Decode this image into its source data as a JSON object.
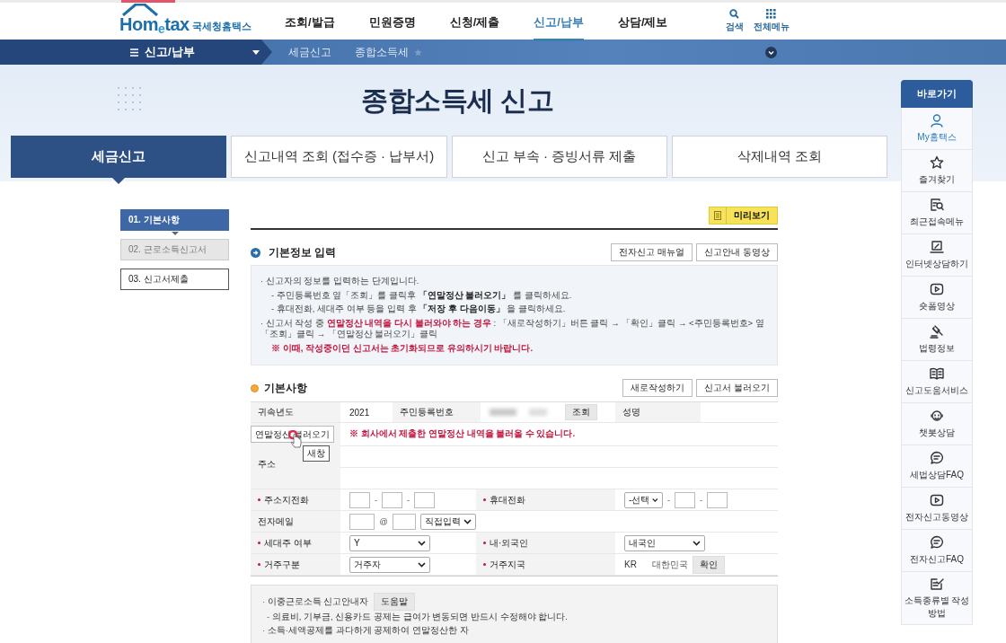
{
  "header": {
    "logo_text": "Hom$_{e}$tax",
    "logo_caption": "국세청홈택스",
    "nav": [
      {
        "label": "조회/발급",
        "selected": false
      },
      {
        "label": "민원증명",
        "selected": false
      },
      {
        "label": "신청/제출",
        "selected": false
      },
      {
        "label": "신고/납부",
        "selected": true
      },
      {
        "label": "상담/제보",
        "selected": false
      }
    ],
    "utilities": [
      {
        "kind": "search",
        "label": "검색"
      },
      {
        "kind": "grid",
        "label": "전체메뉴"
      }
    ]
  },
  "subbar": {
    "menu": "신고/납부",
    "breadcrumb": [
      "세금신고",
      "종합소득세"
    ]
  },
  "page_title": "종합소득세 신고",
  "tabs": [
    {
      "label": "세금신고",
      "selected": true
    },
    {
      "label": "신고내역 조회 (접수증 · 납부서)",
      "selected": false
    },
    {
      "label": "신고 부속 · 증빙서류 제출",
      "selected": false
    },
    {
      "label": "삭제내역 조회",
      "selected": false
    }
  ],
  "steps": [
    {
      "label": "01. 기본사항",
      "selected": true,
      "disabled": false
    },
    {
      "label": "02. 근로소득신고서",
      "selected": false,
      "disabled": true
    },
    {
      "label": "03. 신고서제출",
      "selected": false,
      "disabled": false
    }
  ],
  "preview_button": "미리보기",
  "basic_input": {
    "title": "기본정보 입력",
    "buttons": [
      "전자신고 매뉴얼",
      "신고안내 동영상"
    ],
    "notes": [
      {
        "kind": "bullet",
        "marker": "·",
        "text": "신고자의 정보를 입력하는 단계입니다."
      },
      {
        "kind": "dash",
        "marker": "-",
        "text": "주민등록번호 옆「조회」를 클릭후 **「연말정산 불러오기」** 를 클릭하세요."
      },
      {
        "kind": "dash",
        "marker": "-",
        "text": "휴대전화, 세대주 여부 등을 입력 후 **「저장 후 다음이동」** 을 클릭하세요."
      },
      {
        "kind": "bullet",
        "marker": "·",
        "text": "신고서 작성 중 **연말정산 내역을 다시 불러와야 하는 경우** : 「새로작성하기」버튼 클릭 → 「확인」클릭 → <주민등록번호> 옆「조회」클릭 → 「연말정산 불러오기」클릭"
      },
      {
        "kind": "warning",
        "text": "※ 이때, 작성중이던 신고서는 초기화되므로 유의하시기 바랍니다."
      }
    ]
  },
  "basic_info": {
    "title": "기본사항",
    "buttons": [
      "새로작성하기",
      "신고서 불러오기"
    ],
    "year_label": "귀속년도",
    "year": "2021",
    "rrn_label": "주민등록번호",
    "lookup_button": "조회",
    "name_label": "성명",
    "import_button": "연말정산 불러오기",
    "import_notice": "※ 회사에서 제출한 연말정산 내역을 불러올 수 있습니다.",
    "tooltip": "새창",
    "address_label": "주소",
    "rows": [
      [
        {
          "label": "주소지전화",
          "required": true,
          "kind": "phone",
          "separator": "-"
        },
        {
          "label": "휴대전화",
          "required": true,
          "kind": "mobile",
          "value": "-선택",
          "separator": "-"
        }
      ],
      [
        {
          "label": "전자메일",
          "required": false,
          "kind": "email",
          "separator": "@",
          "value": "직접입력"
        }
      ],
      [
        {
          "label": "세대주 여부",
          "required": true,
          "kind": "select",
          "value": "Y"
        },
        {
          "label": "내·외국인",
          "required": true,
          "kind": "select",
          "value": "내국인"
        }
      ],
      [
        {
          "label": "거주구분",
          "required": true,
          "kind": "select",
          "value": "거주자"
        },
        {
          "label": "거주지국",
          "required": true,
          "kind": "country",
          "code": "KR",
          "value": "대한민국",
          "button": "확인"
        }
      ]
    ]
  },
  "guide": [
    {
      "kind": "bullet",
      "marker": "·",
      "text": "이중근로소득 신고안내자",
      "button": "도움말"
    },
    {
      "kind": "dash",
      "marker": "-",
      "text": "의료비, 기부금, 신용카드 공제는 급여가 변동되면 반드시 수정해야 합니다."
    },
    {
      "kind": "bullet",
      "marker": "·",
      "text": "소득·세액공제를 과다하게 공제하여 연말정산한 자"
    }
  ],
  "quick_menu": {
    "title": "바로가기",
    "items": [
      {
        "kind": "person",
        "label": "My홈택스",
        "selected": true
      },
      {
        "kind": "star",
        "label": "즐겨찾기",
        "selected": false
      },
      {
        "kind": "doc-search",
        "label": "최근접속메뉴",
        "selected": false
      },
      {
        "kind": "laptop",
        "label": "인터넷상담하기",
        "selected": false
      },
      {
        "kind": "play",
        "label": "숏폼영상",
        "selected": false
      },
      {
        "kind": "gavel",
        "label": "법령정보",
        "selected": false
      },
      {
        "kind": "book",
        "label": "신고도움서비스",
        "selected": false
      },
      {
        "kind": "headset",
        "label": "챗봇상담",
        "selected": false
      },
      {
        "kind": "chat",
        "label": "세법상담FAQ",
        "selected": false
      },
      {
        "kind": "play",
        "label": "전자신고동영상",
        "selected": false
      },
      {
        "kind": "chat",
        "label": "전자신고FAQ",
        "selected": false
      },
      {
        "kind": "edit",
        "label": "소득종류별 작성방법",
        "selected": false
      }
    ]
  }
}
